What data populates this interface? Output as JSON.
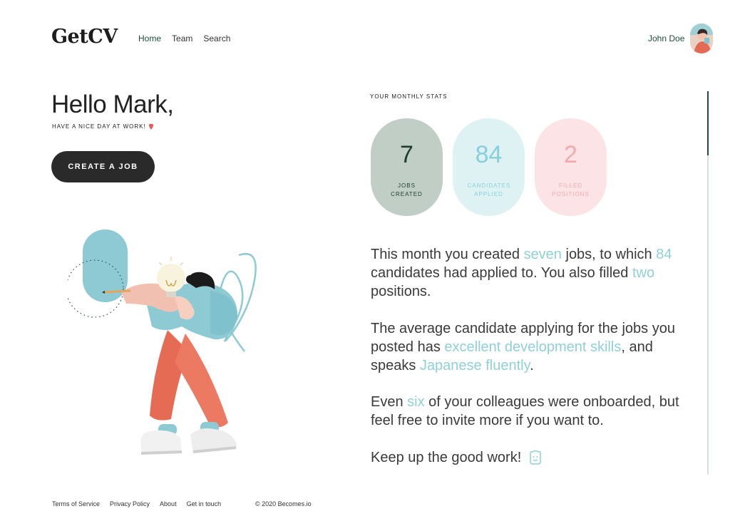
{
  "header": {
    "logo": "GetCV",
    "nav": [
      {
        "label": "Home",
        "active": true
      },
      {
        "label": "Team",
        "active": false
      },
      {
        "label": "Search",
        "active": false
      }
    ],
    "user_name": "John Doe"
  },
  "greeting": {
    "title": "Hello Mark,",
    "subtitle": "HAVE A NICE DAY AT WORK!",
    "create_button": "CREATE A JOB"
  },
  "stats": {
    "title": "YOUR MONTHLY STATS",
    "items": [
      {
        "value": "7",
        "label": "JOBS CREATED"
      },
      {
        "value": "84",
        "label": "CANDIDATES APPLIED"
      },
      {
        "value": "2",
        "label": "FILLED POSITIONS"
      }
    ]
  },
  "summary": {
    "p1": {
      "t1": "This month you created ",
      "h1": "seven",
      "t2": " jobs, to which ",
      "h2": "84",
      "t3": " candidates had applied to. You also filled ",
      "h3": "two",
      "t4": " positions."
    },
    "p2": {
      "t1": "The average candidate applying for the jobs you posted has ",
      "h1": "excellent development skills",
      "t2": ", and speaks ",
      "h2": "Japanese fluently",
      "t3": "."
    },
    "p3": {
      "t1": "Even ",
      "h1": "six",
      "t2": " of your colleagues were onboarded, but feel free to invite more if you want to."
    },
    "p4": "Keep up the good work!"
  },
  "footer": {
    "links": [
      "Terms of Service",
      "Privacy Policy",
      "About",
      "Get in touch"
    ],
    "copyright": "© 2020 Becomes.io"
  },
  "colors": {
    "accent_green": "#1f4d3a",
    "highlight_teal": "#8fd0d9",
    "stat_jobs_bg": "#c0cec6",
    "stat_candidates_bg": "#def2f4",
    "stat_filled_bg": "#fce3e5",
    "heart": "#e85a5a"
  },
  "icons": [
    "heart-icon",
    "smile-icon",
    "avatar"
  ]
}
